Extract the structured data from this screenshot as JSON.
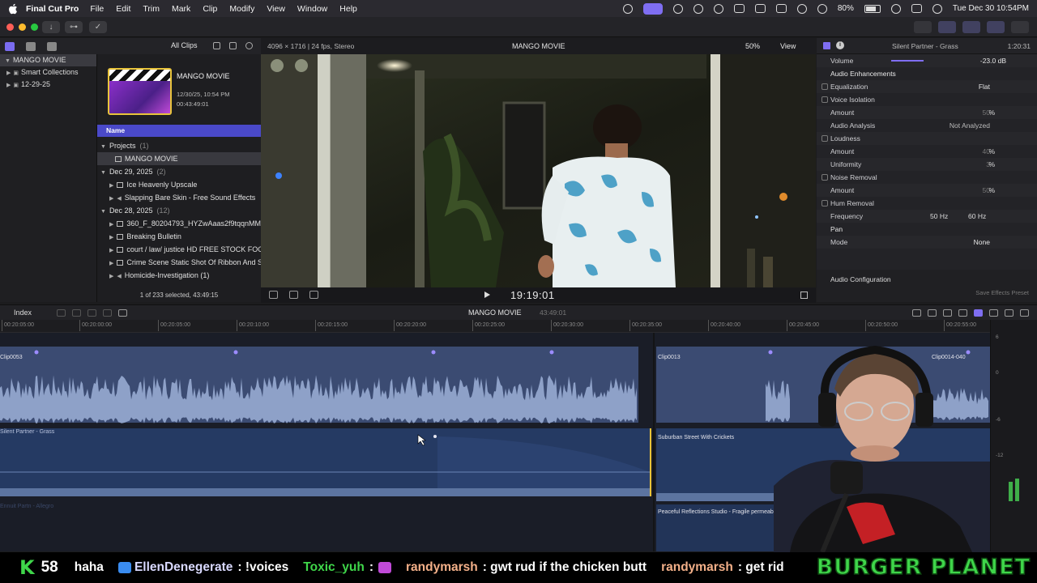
{
  "menubar": {
    "app_name": "Final Cut Pro",
    "menus": [
      "File",
      "Edit",
      "Trim",
      "Mark",
      "Clip",
      "Modify",
      "View",
      "Window",
      "Help"
    ],
    "battery": "80%",
    "clock": "Tue Dec 30  10:54PM"
  },
  "library": {
    "filter_label": "All Clips",
    "sidebar": [
      {
        "label": "MANGO MOVIE",
        "selected": true
      },
      {
        "label": "Smart Collections"
      },
      {
        "label": "12-29-25"
      }
    ],
    "project": {
      "title": "MANGO MOVIE",
      "date": "12/30/25, 10:54 PM",
      "duration": "00:43:49:01"
    },
    "column_header": "Name",
    "groups": [
      {
        "label": "Projects",
        "count": "(1)",
        "items": [
          "MANGO MOVIE"
        ]
      },
      {
        "label": "Dec 29, 2025",
        "count": "(2)",
        "items": [
          "Ice Heavenly Upscale",
          "Slapping Bare Skin - Free Sound Effects"
        ]
      },
      {
        "label": "Dec 28, 2025",
        "count": "(12)",
        "items": [
          "360_F_80204793_HYZwAaas2f9tqqnMM",
          "Breaking Bulletin",
          "court / law/ justice HD FREE STOCK FOO",
          "Crime Scene Static Shot Of Ribbon And S",
          "Homicide-Investigation (1)"
        ]
      }
    ],
    "footer": "1 of 233 selected, 43:49:15"
  },
  "viewer": {
    "format": "4096 × 1716 | 24 fps, Stereo",
    "title": "MANGO MOVIE",
    "zoom": "50%",
    "view_label": "View",
    "timecode": "19:19:01"
  },
  "inspector": {
    "clip_name": "Silent Partner - Grass",
    "duration": "1:20:31",
    "volume_label": "Volume",
    "volume_value": "-23.0 dB",
    "enhancements_label": "Audio Enhancements",
    "rows": [
      {
        "label": "Equalization",
        "check": true,
        "value": "Flat"
      },
      {
        "label": "Voice Isolation",
        "check": true
      },
      {
        "label": "Amount",
        "pct": "50",
        "unit": "%"
      },
      {
        "label": "Audio Analysis",
        "value": "Not Analyzed"
      },
      {
        "label": "Loudness",
        "check": true
      },
      {
        "label": "Amount",
        "pct": "40",
        "unit": "%"
      },
      {
        "label": "Uniformity",
        "pct": "3",
        "unit": "%"
      },
      {
        "label": "Noise Removal",
        "check": true
      },
      {
        "label": "Amount",
        "pct": "50",
        "unit": "%"
      },
      {
        "label": "Hum Removal",
        "check": true
      }
    ],
    "frequency_label": "Frequency",
    "freq_a": "50 Hz",
    "freq_b": "60 Hz",
    "pan_label": "Pan",
    "mode_label": "Mode",
    "mode_value": "None",
    "config_label": "Audio Configuration",
    "save_preset": "Save Effects Preset"
  },
  "timeline": {
    "index_label": "Index",
    "project": "MANGO MOVIE",
    "duration": "43:49:01",
    "ruler": [
      "00:20:05:00",
      "00:20:00:00",
      "00:20:05:00",
      "00:20:10:00",
      "00:20:15:00",
      "00:20:20:00",
      "00:20:25:00",
      "00:20:30:00",
      "00:20:35:00",
      "00:20:40:00",
      "00:20:45:00",
      "00:20:50:00",
      "00:20:55:00"
    ],
    "clips": {
      "clip1": "Clip0053",
      "clip2": "Clip0013",
      "clip3": "Clip0014-040",
      "music1": "Silent Partner - Grass",
      "music2": "Suburban Street With Crickets",
      "music3": "Peaceful Reflections Studio - Fragile permeabili",
      "music4": "Ennuit Partn - Allegro"
    },
    "meter_labels": [
      "6",
      "0",
      "-6",
      "-12"
    ]
  },
  "chat": {
    "k_count": "58",
    "messages": [
      {
        "user": "",
        "text": "haha"
      },
      {
        "user": "EllenDenegerate",
        "text": ": !voices"
      },
      {
        "user": "Toxic_yuh",
        "text": ":"
      },
      {
        "user": "randymarsh",
        "text": ": gwt rud if the chicken butt"
      },
      {
        "user": "randymarsh",
        "text": ": get rid"
      }
    ],
    "brand": "BURGER PLANET"
  }
}
